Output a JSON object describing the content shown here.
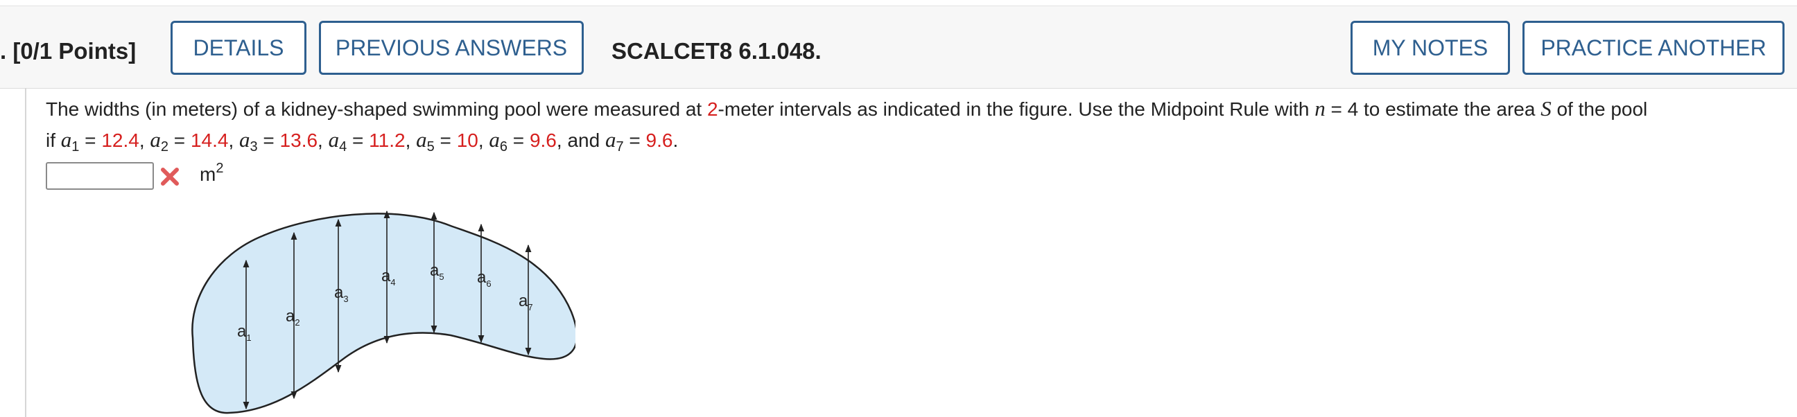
{
  "header": {
    "points": ". [0/1 Points]",
    "details_label": "DETAILS",
    "previous_answers_label": "PREVIOUS ANSWERS",
    "question_id": "SCALCET8 6.1.048.",
    "my_notes_label": "MY NOTES",
    "practice_another_label": "PRACTICE ANOTHER"
  },
  "question": {
    "line1_a": "The widths (in meters) of a kidney-shaped swimming pool were measured at ",
    "interval": "2",
    "line1_b": "-meter intervals as indicated in the figure. Use the Midpoint Rule with ",
    "n_var": "n",
    "n_eq": " = 4 to estimate the area ",
    "s_var": "S",
    "line1_c": " of the pool",
    "if_word": "if ",
    "measurements": [
      {
        "var": "a",
        "sub": "1",
        "value": "12.4"
      },
      {
        "var": "a",
        "sub": "2",
        "value": "14.4"
      },
      {
        "var": "a",
        "sub": "3",
        "value": "13.6"
      },
      {
        "var": "a",
        "sub": "4",
        "value": "11.2"
      },
      {
        "var": "a",
        "sub": "5",
        "value": "10"
      },
      {
        "var": "a",
        "sub": "6",
        "value": "9.6"
      },
      {
        "var": "a",
        "sub": "7",
        "value": "9.6"
      }
    ],
    "and_word": "and"
  },
  "answer": {
    "value": "",
    "status_icon": "incorrect-x-icon",
    "unit_base": "m",
    "unit_exp": "2"
  },
  "figure": {
    "labels": [
      "a1",
      "a2",
      "a3",
      "a4",
      "a5",
      "a6",
      "a7"
    ],
    "fill_color": "#d4e9f7",
    "stroke_color": "#222222"
  },
  "colors": {
    "accent": "#2e5f8f",
    "value_red": "#d6201f",
    "error_red": "#e05a5a"
  }
}
